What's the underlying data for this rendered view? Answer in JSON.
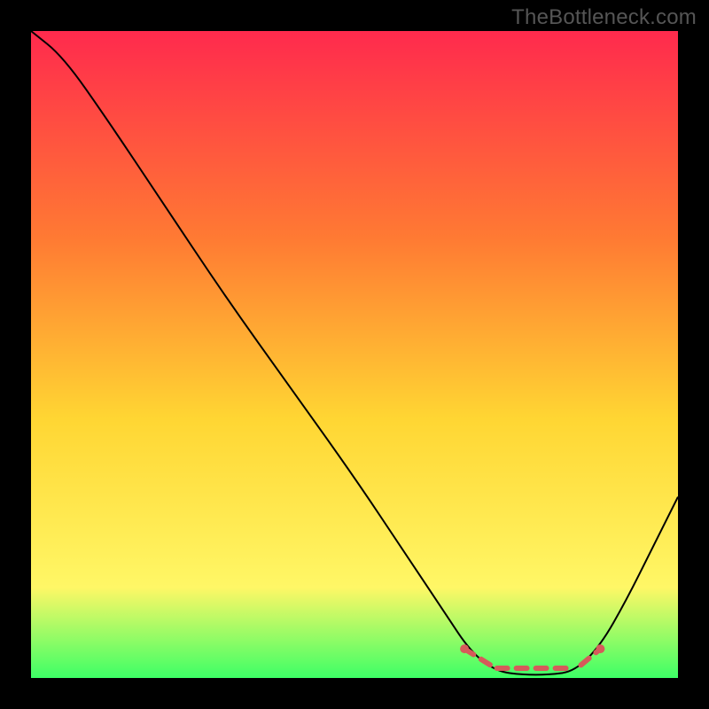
{
  "watermark": "TheBottleneck.com",
  "chart_data": {
    "type": "line",
    "title": "",
    "xlabel": "",
    "ylabel": "",
    "xlim": [
      0,
      100
    ],
    "ylim": [
      0,
      100
    ],
    "background_gradient": {
      "top": "#ff2a4d",
      "mid_upper": "#ff7a33",
      "mid": "#ffd633",
      "mid_lower": "#fff766",
      "bottom": "#3dff66"
    },
    "curve": {
      "color": "#000000",
      "stroke_width": 2,
      "points": [
        {
          "x": 0,
          "y": 100
        },
        {
          "x": 5,
          "y": 96
        },
        {
          "x": 12,
          "y": 86
        },
        {
          "x": 20,
          "y": 74
        },
        {
          "x": 30,
          "y": 59
        },
        {
          "x": 40,
          "y": 45
        },
        {
          "x": 50,
          "y": 31
        },
        {
          "x": 58,
          "y": 19
        },
        {
          "x": 64,
          "y": 10
        },
        {
          "x": 68,
          "y": 4
        },
        {
          "x": 72,
          "y": 1
        },
        {
          "x": 76,
          "y": 0.5
        },
        {
          "x": 80,
          "y": 0.5
        },
        {
          "x": 84,
          "y": 1
        },
        {
          "x": 88,
          "y": 5
        },
        {
          "x": 92,
          "y": 12
        },
        {
          "x": 96,
          "y": 20
        },
        {
          "x": 100,
          "y": 28
        }
      ]
    },
    "valley_markers": {
      "color": "#d65a5a",
      "stroke_width": 6,
      "dash": "12 10",
      "endpoints_radius": 5,
      "segments": [
        {
          "x1": 67,
          "y1": 4.5,
          "x2": 71,
          "y2": 2
        },
        {
          "x1": 72,
          "y1": 1.5,
          "x2": 84,
          "y2": 1.5
        },
        {
          "x1": 85,
          "y1": 2,
          "x2": 88,
          "y2": 4.5
        }
      ]
    }
  }
}
